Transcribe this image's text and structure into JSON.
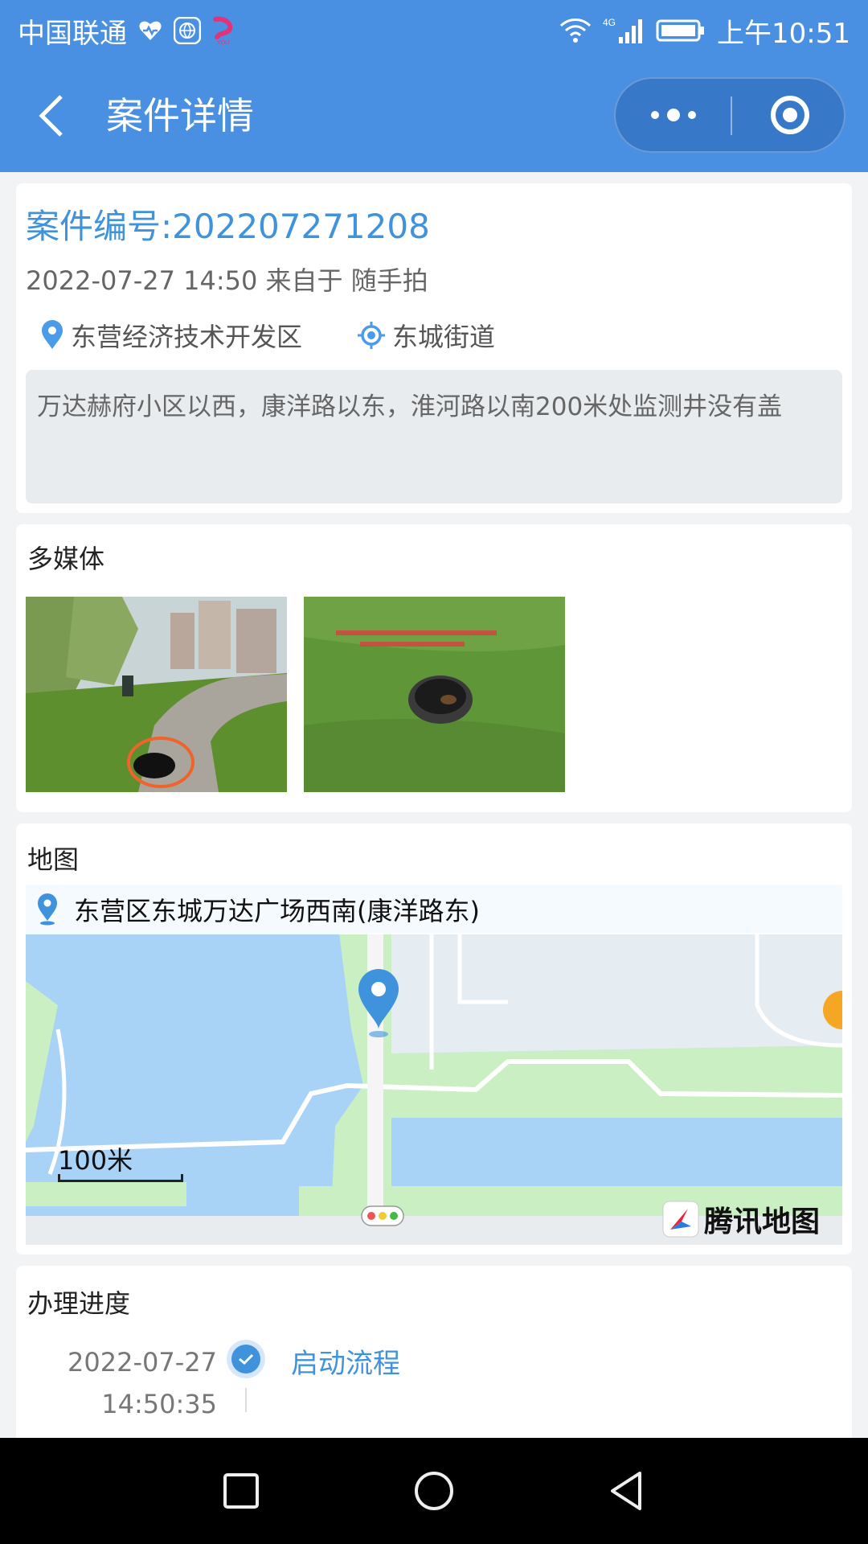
{
  "status_bar": {
    "carrier": "中国联通",
    "network": "4G",
    "time": "上午10:51"
  },
  "header": {
    "title": "案件详情"
  },
  "case": {
    "number_label": "案件编号:202207271208",
    "meta": "2022-07-27 14:50 来自于 随手拍",
    "district": "东营经济技术开发区",
    "street": "东城街道",
    "description": "万达赫府小区以西，康洋路以东，淮河路以南200米处监测井没有盖"
  },
  "media": {
    "title": "多媒体"
  },
  "map": {
    "title": "地图",
    "address": "东营区东城万达广场西南(康洋路东)",
    "scale": "100米",
    "brand": "腾讯地图"
  },
  "progress": {
    "title": "办理进度",
    "items": [
      {
        "date": "2022-07-27",
        "time": "14:50:35",
        "label": "启动流程"
      }
    ]
  },
  "colors": {
    "primary": "#4a90e2",
    "accent_text": "#3f93dd",
    "nav_bar": "#000000"
  }
}
